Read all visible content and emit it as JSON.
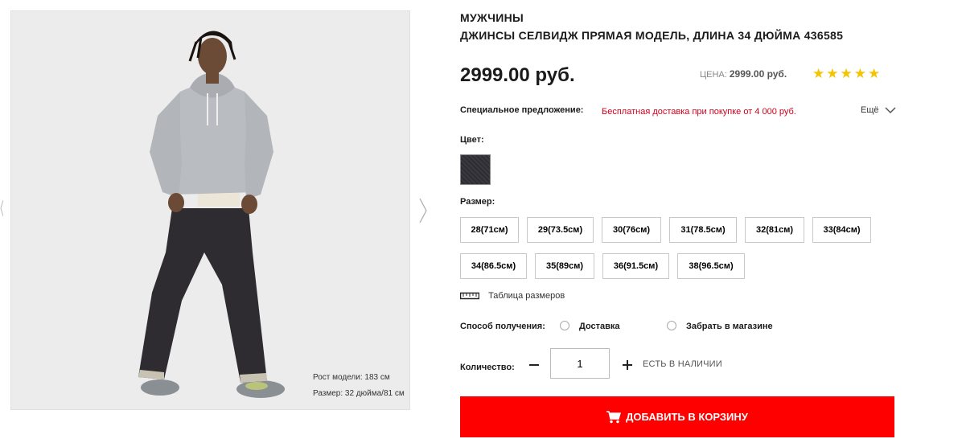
{
  "product": {
    "category": "МУЖЧИНЫ",
    "title": "ДЖИНСЫ СЕЛВИДЖ ПРЯМАЯ МОДЕЛЬ, ДЛИНА 34 ДЮЙМА 436585",
    "price": "2999.00 руб.",
    "price_label": "ЦЕНА:",
    "price_small": "2999.00 руб.",
    "rating_stars": "★★★★★",
    "rating_value": 5
  },
  "photo": {
    "caption_height": "Рост модели: 183 см",
    "caption_size": "Размер: 32 дюйма/81 см"
  },
  "offer": {
    "label": "Специальное предложение:",
    "text": "Бесплатная доставка при покупке от 4 000 руб.",
    "more": "Ещё"
  },
  "color": {
    "label": "Цвет:",
    "swatch_color": "#2f2d34"
  },
  "size": {
    "label": "Размер:",
    "options": [
      "28(71см)",
      "29(73.5см)",
      "30(76см)",
      "31(78.5см)",
      "32(81см)",
      "33(84см)",
      "34(86.5см)",
      "35(89см)",
      "36(91.5см)",
      "38(96.5см)"
    ],
    "chart_link": "Таблица размеров"
  },
  "delivery": {
    "label": "Способ получения:",
    "options": [
      "Доставка",
      "Забрать в магазине"
    ]
  },
  "quantity": {
    "label": "Количество:",
    "value": "1",
    "stock": "ЕСТЬ В НАЛИЧИИ"
  },
  "cart": {
    "label": "ДОБАВИТЬ В КОРЗИНУ",
    "color": "#ff0000"
  },
  "colors": {
    "accent": "#ff0000",
    "offer_text": "#d0021b",
    "stars": "#f5c400"
  }
}
